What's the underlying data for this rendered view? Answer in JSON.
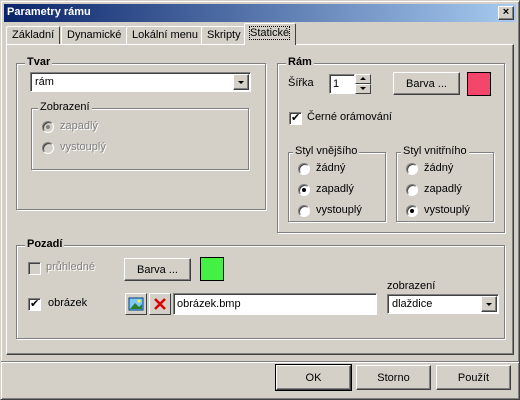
{
  "window": {
    "title": "Parametry rámu",
    "close_glyph": "×"
  },
  "tabs": [
    {
      "label": "Základní"
    },
    {
      "label": "Dynamické"
    },
    {
      "label": "Lokální menu"
    },
    {
      "label": "Skripty"
    },
    {
      "label": "Statické"
    }
  ],
  "tvar": {
    "title": "Tvar",
    "shape_value": "rám",
    "zobrazeni": {
      "title": "Zobrazení",
      "options": [
        "zapadlý",
        "vystouplý"
      ],
      "selected": "zapadlý"
    }
  },
  "ram": {
    "title": "Rám",
    "sirka_label": "Šířka",
    "sirka_value": "1",
    "barva_label": "Barva ...",
    "color": "#f4456a",
    "black_border_label": "Černé orámování",
    "black_border_checked": true,
    "outer_style": {
      "title": "Styl vnějšího",
      "options": [
        "žádný",
        "zapadlý",
        "vystouplý"
      ],
      "selected": "zapadlý"
    },
    "inner_style": {
      "title": "Styl vnitřního",
      "options": [
        "žádný",
        "zapadlý",
        "vystouplý"
      ],
      "selected": "vystouplý"
    }
  },
  "pozadi": {
    "title": "Pozadí",
    "transparent_label": "průhledné",
    "transparent_checked": false,
    "barva_label": "Barva ...",
    "color": "#44f044",
    "image_label": "obrázek",
    "image_checked": true,
    "image_file": "obrázek.bmp",
    "display_label": "zobrazení",
    "display_value": "dlaždice"
  },
  "buttons": {
    "ok": "OK",
    "cancel": "Storno",
    "apply": "Použít"
  }
}
